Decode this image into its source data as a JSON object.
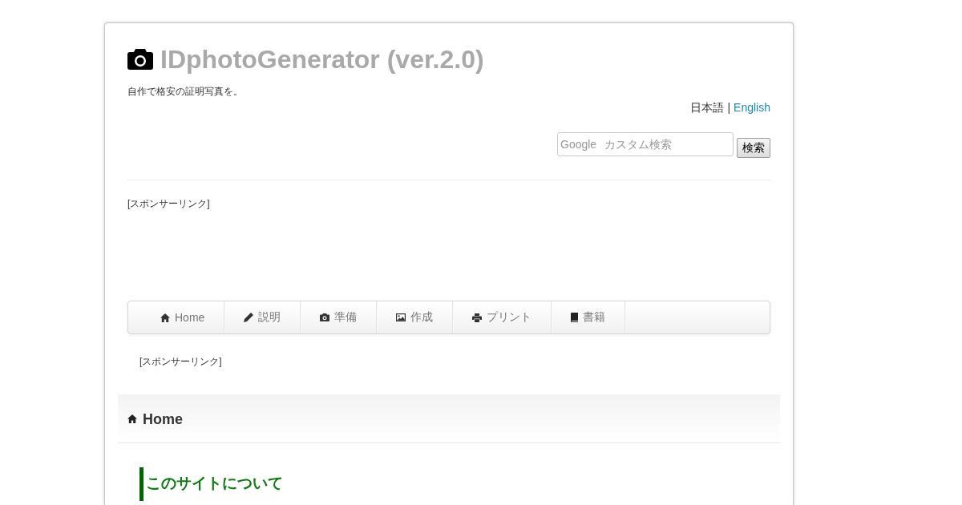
{
  "header": {
    "title": "IDphotoGenerator (ver.2.0)",
    "tagline": "自作で格安の証明写真を。",
    "languages": [
      {
        "label": "日本語",
        "selected": true
      },
      {
        "label": "English",
        "selected": false
      }
    ],
    "separator": "|"
  },
  "search": {
    "placeholder": "Google カスタム検索",
    "button": "検索"
  },
  "ad_top": {
    "label": "[スポンサーリンク]"
  },
  "nav": {
    "items": [
      {
        "label": "Home",
        "selected": false
      },
      {
        "label": "説明",
        "selected": false
      },
      {
        "label": "準備",
        "selected": false
      },
      {
        "label": "作成",
        "selected": false
      },
      {
        "label": "プリント",
        "selected": false
      },
      {
        "label": "書籍",
        "selected": false
      }
    ]
  },
  "ad_bottom": {
    "label": "[スポンサーリンク]"
  },
  "section": {
    "title": "Home",
    "heading": "このサイトについて"
  }
}
